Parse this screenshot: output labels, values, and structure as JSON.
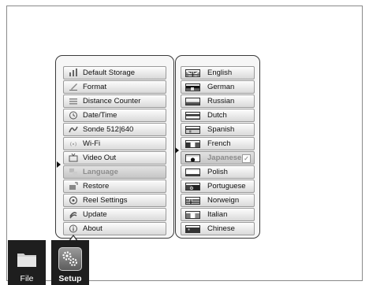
{
  "settings_menu": {
    "items": [
      {
        "label": "Default Storage",
        "icon": "storage-icon"
      },
      {
        "label": "Format",
        "icon": "format-icon"
      },
      {
        "label": "Distance Counter",
        "icon": "distance-counter-icon"
      },
      {
        "label": "Date/Time",
        "icon": "clock-icon"
      },
      {
        "label": "Sonde 512|640",
        "icon": "sonde-icon"
      },
      {
        "label": "Wi-Fi",
        "icon": "wifi-icon"
      },
      {
        "label": "Video Out",
        "icon": "video-out-icon"
      },
      {
        "label": "Language",
        "icon": "language-icon",
        "selected": true
      },
      {
        "label": "Restore",
        "icon": "restore-icon"
      },
      {
        "label": "Reel Settings",
        "icon": "reel-icon"
      },
      {
        "label": "Update",
        "icon": "update-icon"
      },
      {
        "label": "About",
        "icon": "info-icon"
      }
    ]
  },
  "language_menu": {
    "items": [
      {
        "label": "English",
        "flag": "uk-flag"
      },
      {
        "label": "German",
        "flag": "german-flag"
      },
      {
        "label": "Russian",
        "flag": "russian-flag"
      },
      {
        "label": "Dutch",
        "flag": "dutch-flag"
      },
      {
        "label": "Spanish",
        "flag": "spanish-flag"
      },
      {
        "label": "French",
        "flag": "french-flag"
      },
      {
        "label": "Japanese",
        "flag": "japanese-flag",
        "selected": true,
        "checked": true
      },
      {
        "label": "Polish",
        "flag": "polish-flag"
      },
      {
        "label": "Portuguese",
        "flag": "portuguese-flag"
      },
      {
        "label": "Norweign",
        "flag": "norwegian-flag"
      },
      {
        "label": "Italian",
        "flag": "italian-flag"
      },
      {
        "label": "Chinese",
        "flag": "chinese-flag"
      }
    ]
  },
  "taskbar": {
    "file_label": "File",
    "setup_label": "Setup",
    "active": "Setup"
  },
  "colors": {
    "panel_border": "#3a3a3a",
    "item_top": "#fdfdfd",
    "item_bottom": "#d9d9d9",
    "selected_text": "#8c8c8c",
    "taskbar_bg": "#1e1e1e"
  }
}
